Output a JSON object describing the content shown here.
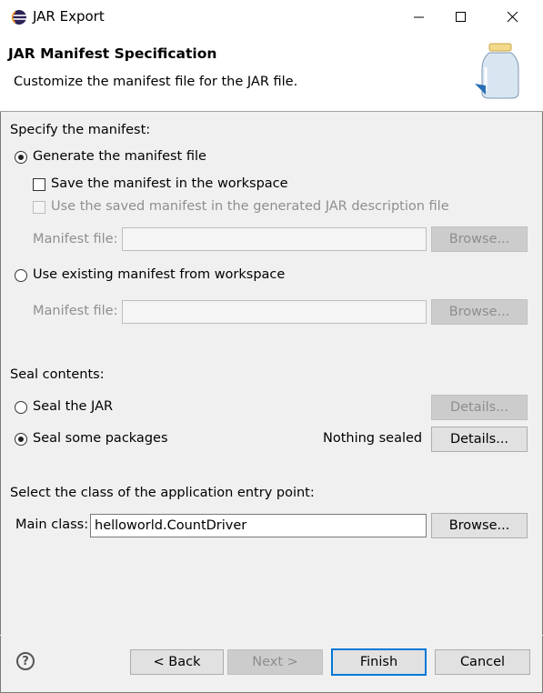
{
  "window": {
    "title": "JAR Export",
    "controls": {
      "minimize": "minimize-icon",
      "maximize": "maximize-icon",
      "close": "close-icon"
    }
  },
  "banner": {
    "title": "JAR Manifest Specification",
    "description": "Customize the manifest file for the JAR file."
  },
  "manifest": {
    "section_label": "Specify the manifest:",
    "generate_option": "Generate the manifest file",
    "save_in_workspace": "Save the manifest in the workspace",
    "use_saved_manifest": "Use the saved manifest in the generated JAR description file",
    "manifest_file_label": "Manifest file:",
    "browse_label": "Browse...",
    "use_existing_option": "Use existing manifest from workspace",
    "manifest_file_label_2": "Manifest file:",
    "browse_label_2": "Browse...",
    "selected_option": "generate"
  },
  "seal": {
    "section_label": "Seal contents:",
    "seal_jar_option": "Seal the JAR",
    "seal_jar_details": "Details...",
    "seal_packages_option": "Seal some packages",
    "status_text": "Nothing sealed",
    "seal_packages_details": "Details...",
    "selected_option": "seal-packages"
  },
  "entry_point": {
    "section_label": "Select the class of the application entry point:",
    "main_class_label": "Main class:",
    "main_class_value": "helloworld.CountDriver",
    "browse_label": "Browse..."
  },
  "footer": {
    "help_icon": "help-icon",
    "help_glyph": "?",
    "back_label": "< Back",
    "next_label": "Next >",
    "finish_label": "Finish",
    "cancel_label": "Cancel"
  },
  "colors": {
    "accent": "#0078d7",
    "background": "#f0f0f0",
    "banner_background": "#ffffff",
    "disabled_text": "#8f8f8f"
  }
}
